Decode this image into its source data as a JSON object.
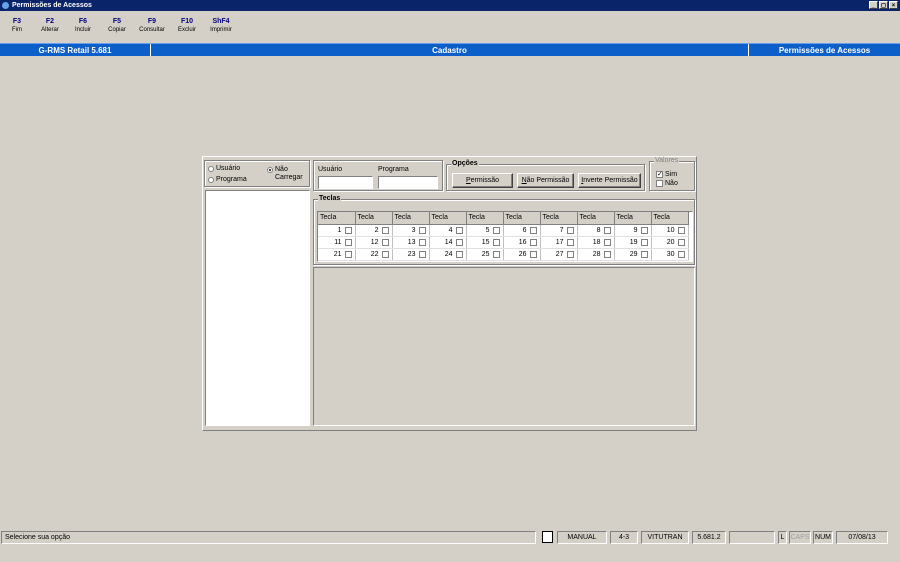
{
  "window": {
    "title": "Permissões de Acessos",
    "controls": [
      "_",
      "◻",
      "×"
    ]
  },
  "fkeys": [
    {
      "key": "F3",
      "label": "Fim"
    },
    {
      "key": "F2",
      "label": "Alterar"
    },
    {
      "key": "F6",
      "label": "Incluir"
    },
    {
      "key": "F5",
      "label": "Copiar"
    },
    {
      "key": "F9",
      "label": "Consultar"
    },
    {
      "key": "F10",
      "label": "Excluir"
    },
    {
      "key": "ShF4",
      "label": "Imprimir"
    }
  ],
  "header": {
    "app": "G-RMS Retail 5.681",
    "section": "Cadastro",
    "screen": "Permissões de Acessos"
  },
  "mode": {
    "usuario": "Usuário",
    "programa": "Programa",
    "nao_carregar": "Não Carregar",
    "selected": "nao_carregar"
  },
  "fields": {
    "usuario_label": "Usuário",
    "programa_label": "Programa",
    "usuario_value": "",
    "programa_value": ""
  },
  "opcoes": {
    "title": "Opções",
    "permissao_pre": "",
    "permissao_u": "P",
    "permissao_post": "ermissão",
    "nao_pre": "",
    "nao_u": "N",
    "nao_post": "ão Permissão",
    "inv_pre": "",
    "inv_u": "I",
    "inv_post": "nverte Permissão"
  },
  "valores": {
    "title": "Valores",
    "sim": "Sim",
    "nao": "Não",
    "sim_checked": true,
    "nao_checked": false
  },
  "teclas": {
    "title": "Teclas",
    "column_header": "Tecla",
    "rows": [
      [
        1,
        2,
        3,
        4,
        5,
        6,
        7,
        8,
        9,
        10
      ],
      [
        11,
        12,
        13,
        14,
        15,
        16,
        17,
        18,
        19,
        20
      ],
      [
        21,
        22,
        23,
        24,
        25,
        26,
        27,
        28,
        29,
        30
      ]
    ]
  },
  "status": {
    "message": "Selecione sua opção",
    "mode": "MANUAL",
    "code": "4-3",
    "user": "VITUTRAN",
    "version": "5.681.2",
    "l": "L",
    "caps": "CAPS",
    "num": "NUM",
    "date": "07/08/13"
  }
}
